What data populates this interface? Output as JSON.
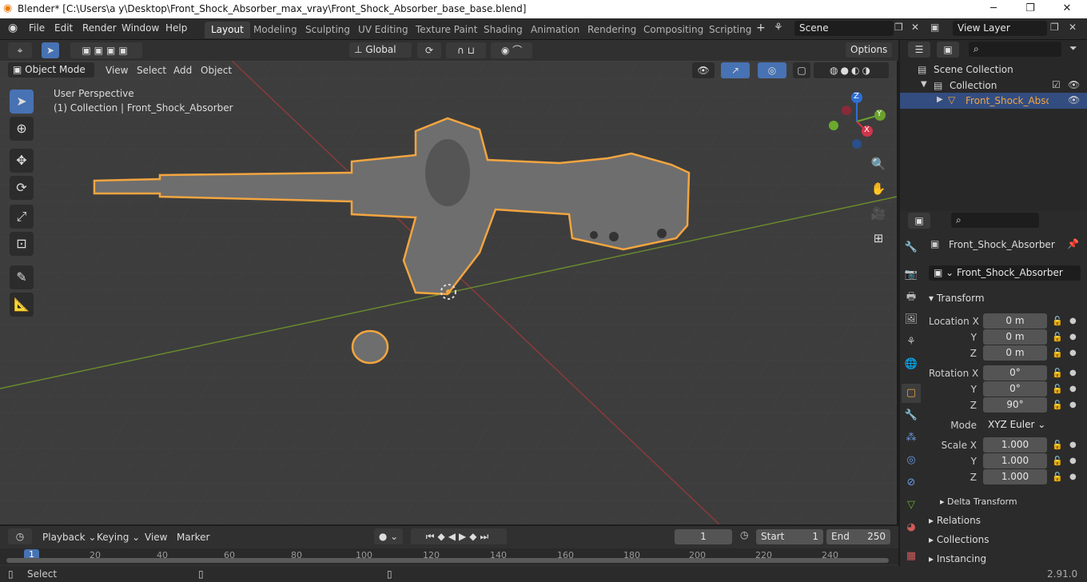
{
  "window": {
    "title": "Blender* [C:\\Users\\a y\\Desktop\\Front_Shock_Absorber_max_vray\\Front_Shock_Absorber_base_base.blend]",
    "minimize": "─",
    "maximize": "❐",
    "close": "✕"
  },
  "menus": [
    "File",
    "Edit",
    "Render",
    "Window",
    "Help"
  ],
  "workspaces": [
    "Layout",
    "Modeling",
    "Sculpting",
    "UV Editing",
    "Texture Paint",
    "Shading",
    "Animation",
    "Rendering",
    "Compositing",
    "Scripting"
  ],
  "workspace_add": "+",
  "scene": {
    "name": "Scene",
    "view_layer": "View Layer"
  },
  "viewport_header": {
    "mode": "Object Mode",
    "menus": [
      "View",
      "Select",
      "Add",
      "Object"
    ],
    "orientation": "Global",
    "options": "Options"
  },
  "viewport": {
    "perspective": "User Perspective",
    "collection_info": "(1) Collection | Front_Shock_Absorber",
    "axes": {
      "x": "X",
      "y": "Y",
      "z": "Z"
    }
  },
  "outliner": {
    "scene_collection": "Scene Collection",
    "collection": "Collection",
    "object": "Front_Shock_Absorber"
  },
  "properties": {
    "object_name": "Front_Shock_Absorber",
    "data_name": "Front_Shock_Absorber",
    "transform_label": "Transform",
    "location": {
      "label": "Location X",
      "y_label": "Y",
      "z_label": "Z",
      "x": "0 m",
      "y": "0 m",
      "z": "0 m"
    },
    "rotation": {
      "label": "Rotation X",
      "y_label": "Y",
      "z_label": "Z",
      "x": "0°",
      "y": "0°",
      "z": "90°"
    },
    "mode_label": "Mode",
    "mode": "XYZ Euler",
    "scale": {
      "label": "Scale X",
      "y_label": "Y",
      "z_label": "Z",
      "x": "1.000",
      "y": "1.000",
      "z": "1.000"
    },
    "delta": "Delta Transform",
    "sections": [
      "Relations",
      "Collections",
      "Instancing"
    ]
  },
  "timeline": {
    "menus": [
      "Playback",
      "Keying",
      "View",
      "Marker"
    ],
    "current_frame": "1",
    "start_label": "Start",
    "start": "1",
    "end_label": "End",
    "end": "250",
    "ticks": [
      "1",
      "20",
      "40",
      "60",
      "80",
      "100",
      "120",
      "140",
      "160",
      "180",
      "200",
      "220",
      "240"
    ]
  },
  "status": {
    "left": "Select",
    "version": "2.91.0"
  },
  "colors": {
    "accent": "#4772b3",
    "selection": "#f2a540",
    "viewport_bg": "#3d3d3d"
  }
}
